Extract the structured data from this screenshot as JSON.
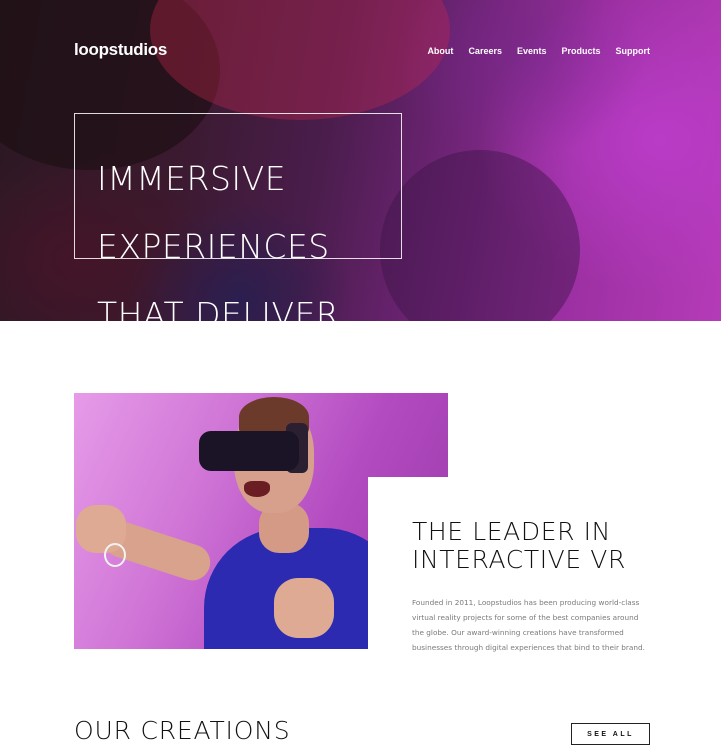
{
  "brand": {
    "name": "loopstudios"
  },
  "nav": {
    "items": [
      {
        "label": "About"
      },
      {
        "label": "Careers"
      },
      {
        "label": "Events"
      },
      {
        "label": "Products"
      },
      {
        "label": "Support"
      }
    ]
  },
  "hero": {
    "title_lines": [
      "IMMERSIVE",
      "EXPERIENCES",
      "THAT DELIVER"
    ]
  },
  "interactive": {
    "title_lines": [
      "THE LEADER IN",
      "INTERACTIVE VR"
    ],
    "body": "Founded in 2011, Loopstudios has been producing world-class virtual reality projects for some of the best companies around the globe. Our award-winning creations have transformed businesses through digital experiences that bind to their brand."
  },
  "creations": {
    "title": "OUR CREATIONS",
    "see_all_label": "SEE ALL"
  },
  "colors": {
    "hero_accent": "#b53bb8",
    "text_dark": "#111111",
    "text_muted": "#7a7a7a"
  }
}
